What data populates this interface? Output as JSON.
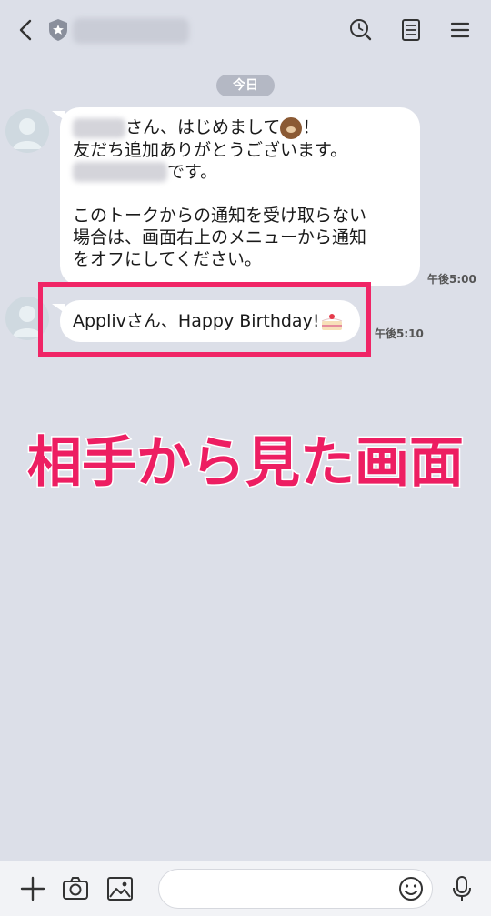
{
  "header": {
    "back_icon": "chevron-left-icon",
    "shield_icon": "shield-star-icon",
    "search_icon": "search-clock-icon",
    "notes_icon": "notes-icon",
    "menu_icon": "hamburger-menu-icon"
  },
  "chat": {
    "date_label": "今日",
    "messages": [
      {
        "line1_text": "さん、はじめまして",
        "line1_suffix": "！",
        "line2": "友だち追加ありがとうございます。",
        "line3_suffix": "です。",
        "line4": "このトークからの通知を受け取らない",
        "line5": "場合は、画面右上のメニューから通知",
        "line6": "をオフにしてください。",
        "time": "午後5:00"
      },
      {
        "text": "Applivさん、Happy Birthday!",
        "time": "午後5:10"
      }
    ]
  },
  "overlay": {
    "caption": "相手から見た画面"
  },
  "composer": {
    "placeholder": "",
    "add_icon": "plus-icon",
    "camera_icon": "camera-icon",
    "image_icon": "image-icon",
    "emoji_icon": "smiley-icon",
    "mic_icon": "microphone-icon"
  },
  "colors": {
    "background": "#dcdfe8",
    "highlight": "#f02566",
    "caption": "#ed1e62"
  }
}
